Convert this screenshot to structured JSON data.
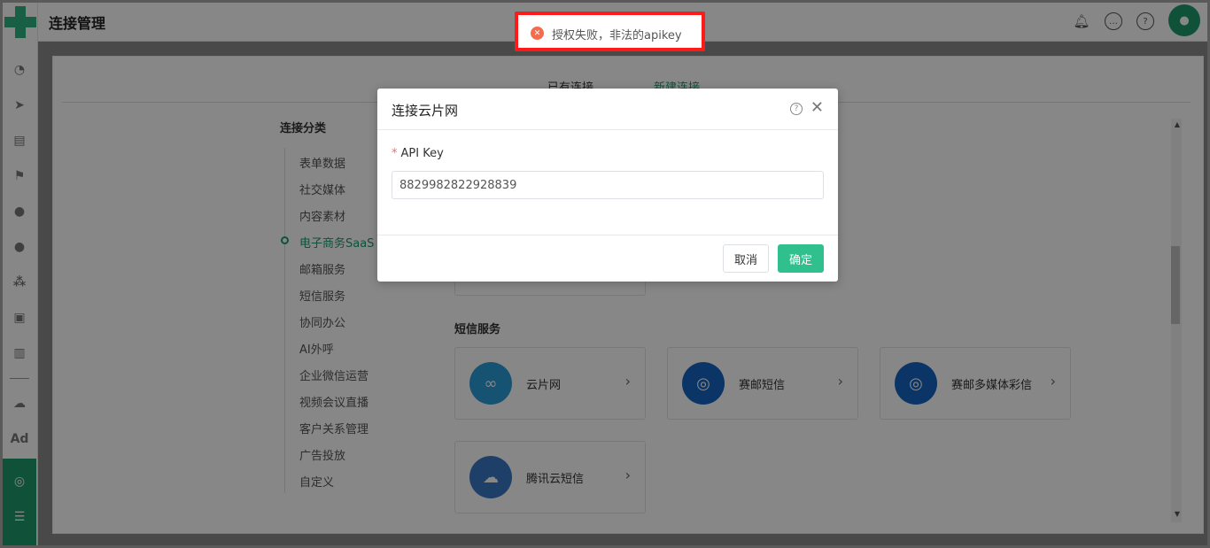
{
  "header": {
    "title": "连接管理"
  },
  "header_icons": [
    "bell-icon",
    "chat-icon",
    "help-icon"
  ],
  "tabs": [
    {
      "label": "已有连接"
    },
    {
      "label": "新建连接",
      "active": true
    }
  ],
  "categories": {
    "title": "连接分类",
    "items": [
      "表单数据",
      "社交媒体",
      "内容素材",
      "电子商务SaaS",
      "邮箱服务",
      "短信服务",
      "协同办公",
      "AI外呼",
      "企业微信运营",
      "视频会议直播",
      "客户关系管理",
      "广告投放",
      "自定义"
    ],
    "active_index": 3
  },
  "sms_section": {
    "title": "短信服务",
    "cards": [
      {
        "label": "云片网",
        "icon": "cloud-link-icon",
        "color": "#2b9bd8"
      },
      {
        "label": "赛邮短信",
        "icon": "swirl-icon",
        "color": "#1565c0"
      },
      {
        "label": "赛邮多媒体彩信",
        "icon": "swirl-icon",
        "color": "#1565c0"
      },
      {
        "label": "腾讯云短信",
        "icon": "cloud-icon",
        "color": "#3a78c4"
      }
    ]
  },
  "sidebar_bottom": {
    "ad_label": "Ad"
  },
  "modal": {
    "title": "连接云片网",
    "field_required_mark": "*",
    "field_label": "API Key",
    "field_value": "8829982822928839",
    "cancel_label": "取消",
    "ok_label": "确定"
  },
  "toast": {
    "text": "授权失败，非法的apikey",
    "icon": "error-circle-icon"
  },
  "colors": {
    "accent": "#1e9a6c",
    "primary_button": "#2fc08e",
    "error": "#f56c4c",
    "toast_border": "#ff1a1a"
  }
}
